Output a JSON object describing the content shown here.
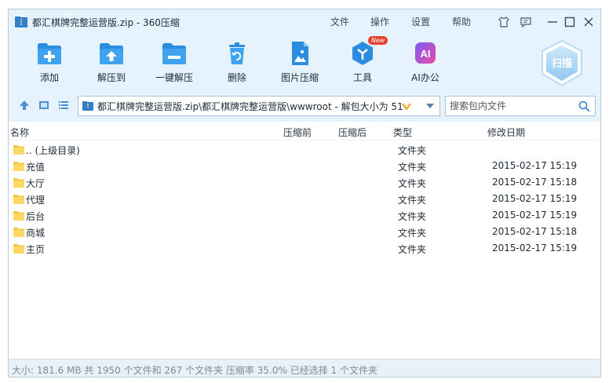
{
  "window": {
    "title": "都汇棋牌完整运营版.zip - 360压缩",
    "menu": [
      "文件",
      "操作",
      "设置",
      "帮助"
    ]
  },
  "toolbar": {
    "buttons": [
      {
        "label": "添加",
        "icon": "add-icon"
      },
      {
        "label": "解压到",
        "icon": "extract-to-icon"
      },
      {
        "label": "一键解压",
        "icon": "one-click-extract-icon"
      },
      {
        "label": "删除",
        "icon": "delete-icon"
      },
      {
        "label": "图片压缩",
        "icon": "image-compress-icon"
      },
      {
        "label": "工具",
        "icon": "tools-icon",
        "badge": "New"
      },
      {
        "label": "AI办公",
        "icon": "ai-office-icon",
        "icon_text": "AI"
      }
    ],
    "scan_label": "扫描"
  },
  "address": {
    "path": "都汇棋牌完整运营版.zip\\都汇棋牌完整运营版\\wwwroot - 解包大小为 51"
  },
  "search": {
    "placeholder": "搜索包内文件"
  },
  "list": {
    "columns": [
      "名称",
      "压缩前",
      "压缩后",
      "类型",
      "修改日期"
    ],
    "rows": [
      {
        "name": ".. (上级目录)",
        "type": "文件夹",
        "date": ""
      },
      {
        "name": "充值",
        "type": "文件夹",
        "date": "2015-02-17 15:19"
      },
      {
        "name": "大厅",
        "type": "文件夹",
        "date": "2015-02-17 15:18"
      },
      {
        "name": "代理",
        "type": "文件夹",
        "date": "2015-02-17 15:19"
      },
      {
        "name": "后台",
        "type": "文件夹",
        "date": "2015-02-17 15:19"
      },
      {
        "name": "商城",
        "type": "文件夹",
        "date": "2015-02-17 15:18"
      },
      {
        "name": "主页",
        "type": "文件夹",
        "date": "2015-02-17 15:19"
      }
    ]
  },
  "status": {
    "text": "大小: 181.6 MB 共 1950 个文件和 267 个文件夹 压缩率 35.0% 已经选择 1 个文件夹"
  },
  "colors": {
    "accent": "#2a8de0",
    "folder": "#f5c542",
    "window_bg": "#e6f2fc"
  }
}
